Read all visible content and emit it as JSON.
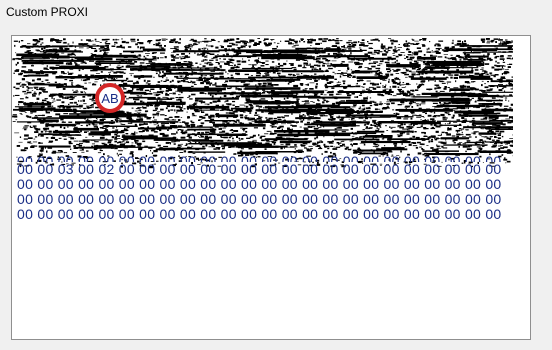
{
  "window": {
    "title": "Custom PROXI"
  },
  "textbox": {
    "marker_label": "AB",
    "hex_lines": [
      "00 00 03 00 02 00 00 00 00 00 00 00 00 00 00 00 00 00 00 00 00 00 00 00",
      "00 00 00 00 00 00 00 00 00 00 00 00 00 00 00 00 00 00 00 00 00 00 00 00",
      "00 00 00 00 00 00 00 00 00 00 00 00 00 00 00 00 00 00 00 00 00 00 00 00",
      "00 00 00 00 00 00 00 00 00 00 00 00 00 00 00 00 00 00 00 00 00 00 00 00"
    ],
    "partial_line": "00 00 00 00 00 00 00 00 00 00 00 00 00 00 00 00 00 00 00 00 00 00 00 00"
  },
  "colors": {
    "hex_text": "#1a2e86",
    "marker_ring": "#d32626",
    "scribble": "#000000"
  }
}
